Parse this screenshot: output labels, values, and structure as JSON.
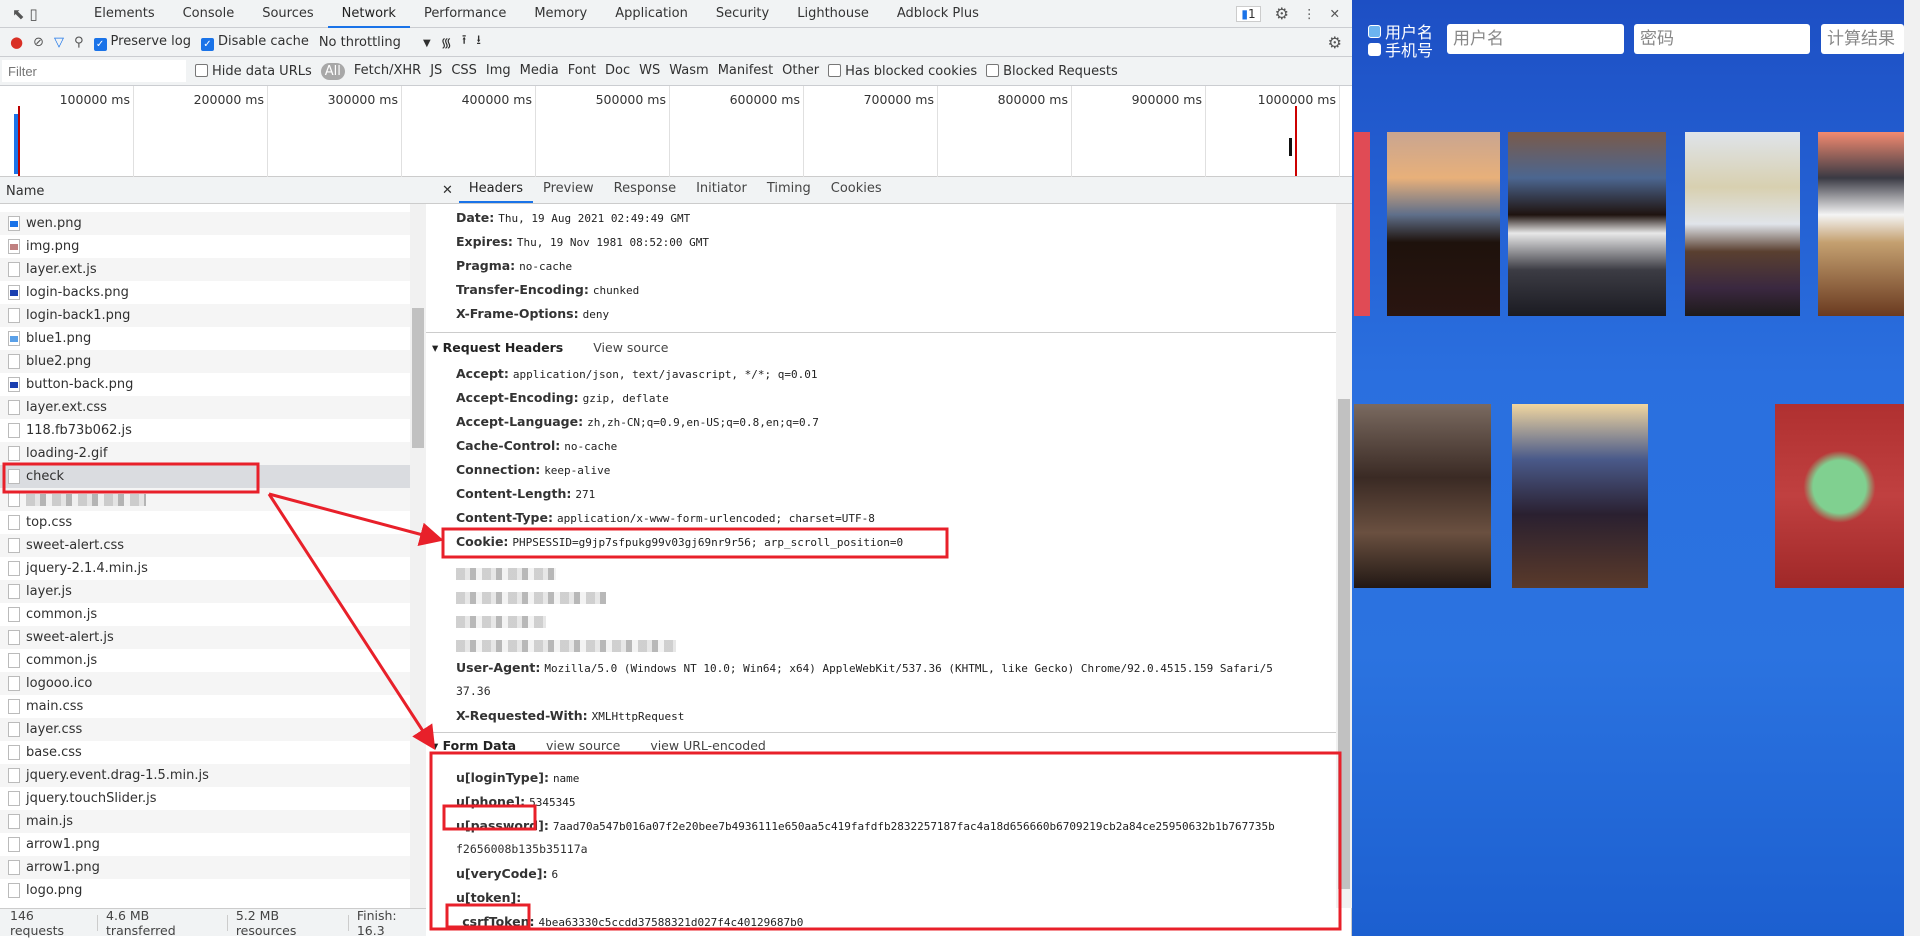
{
  "devtools": {
    "tabs": [
      "Elements",
      "Console",
      "Sources",
      "Network",
      "Performance",
      "Memory",
      "Application",
      "Security",
      "Lighthouse",
      "Adblock Plus"
    ],
    "active_tab": "Network",
    "issues_badge": "1",
    "toolbar": {
      "preserve_log": "Preserve log",
      "disable_cache": "Disable cache",
      "throttling": "No throttling"
    },
    "filter": {
      "placeholder": "Filter",
      "hide_data_urls": "Hide data URLs",
      "types": [
        "All",
        "Fetch/XHR",
        "JS",
        "CSS",
        "Img",
        "Media",
        "Font",
        "Doc",
        "WS",
        "Wasm",
        "Manifest",
        "Other"
      ],
      "has_blocked_cookies": "Has blocked cookies",
      "blocked_requests": "Blocked Requests"
    },
    "timeline_ticks": [
      "100000 ms",
      "200000 ms",
      "300000 ms",
      "400000 ms",
      "500000 ms",
      "600000 ms",
      "700000 ms",
      "800000 ms",
      "900000 ms",
      "1000000 ms"
    ],
    "name_header": "Name",
    "requests": [
      "wen.png",
      "img.png",
      "layer.ext.js",
      "login-backs.png",
      "login-back1.png",
      "blue1.png",
      "blue2.png",
      "button-back.png",
      "layer.ext.css",
      "118.fb73b062.js",
      "loading-2.gif",
      "check",
      "",
      "top.css",
      "sweet-alert.css",
      "jquery-2.1.4.min.js",
      "layer.js",
      "common.js",
      "sweet-alert.js",
      "common.js",
      "logooo.ico",
      "main.css",
      "layer.css",
      "base.css",
      "jquery.event.drag-1.5.min.js",
      "jquery.touchSlider.js",
      "main.js",
      "arrow1.png",
      "arrow1.png",
      "logo.png"
    ],
    "selected_request": "check",
    "status": {
      "requests": "146 requests",
      "transferred": "4.6 MB transferred",
      "resources": "5.2 MB resources",
      "finish": "Finish: 16.3"
    },
    "detail_tabs": [
      "Headers",
      "Preview",
      "Response",
      "Initiator",
      "Timing",
      "Cookies"
    ],
    "response_headers": [
      {
        "k": "Date:",
        "v": "Thu, 19 Aug 2021 02:49:49 GMT"
      },
      {
        "k": "Expires:",
        "v": "Thu, 19 Nov 1981 08:52:00 GMT"
      },
      {
        "k": "Pragma:",
        "v": "no-cache"
      },
      {
        "k": "Transfer-Encoding:",
        "v": "chunked"
      },
      {
        "k": "X-Frame-Options:",
        "v": "deny"
      }
    ],
    "request_headers_title": "Request Headers",
    "view_source": "View source",
    "request_headers": [
      {
        "k": "Accept:",
        "v": "application/json, text/javascript, */*; q=0.01"
      },
      {
        "k": "Accept-Encoding:",
        "v": "gzip, deflate"
      },
      {
        "k": "Accept-Language:",
        "v": "zh,zh-CN;q=0.9,en-US;q=0.8,en;q=0.7"
      },
      {
        "k": "Cache-Control:",
        "v": "no-cache"
      },
      {
        "k": "Connection:",
        "v": "keep-alive"
      },
      {
        "k": "Content-Length:",
        "v": "271"
      },
      {
        "k": "Content-Type:",
        "v": "application/x-www-form-urlencoded; charset=UTF-8"
      },
      {
        "k": "Cookie:",
        "v": "PHPSESSID=g9jp7sfpukg99v03gj69nr9r56; arp_scroll_position=0"
      }
    ],
    "user_agent": {
      "k": "User-Agent:",
      "v": "Mozilla/5.0 (Windows NT 10.0; Win64; x64) AppleWebKit/537.36 (KHTML, like Gecko) Chrome/92.0.4515.159 Safari/5",
      "v2": "37.36"
    },
    "x_requested_with": {
      "k": "X-Requested-With:",
      "v": "XMLHttpRequest"
    },
    "form_data_title": "Form Data",
    "form_view_source": "view source",
    "form_view_url": "view URL-encoded",
    "form_data": [
      {
        "k": "u[loginType]:",
        "v": "name"
      },
      {
        "k": "u[phone]:",
        "v": "5345345"
      },
      {
        "k": "u[password]:",
        "v": "7aad70a547b016a07f2e20bee7b4936111e650aa5c419fafdfb2832257187fac4a18d656660b6709219cb2a84ce25950632b1b767735b",
        "v2": "f2656008b135b35117a"
      },
      {
        "k": "u[veryCode]:",
        "v": "6"
      },
      {
        "k": "u[token]:",
        "v": ""
      },
      {
        "k": "_csrfToken:",
        "v": "4bea63330c5ccdd37588321d027f4c40129687b0"
      }
    ]
  },
  "page": {
    "radio_username": "用户名",
    "radio_phone": "手机号",
    "username_placeholder": "用户名",
    "password_placeholder": "密码",
    "result_placeholder": "计算结果"
  },
  "colors": {
    "accent": "#1a73e8",
    "annotation": "#e8202a",
    "page_bg": "#2b6fdf"
  }
}
